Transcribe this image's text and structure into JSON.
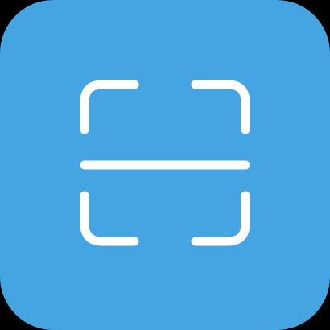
{
  "app_icon": {
    "icon": "scan-icon",
    "background_color": "#45A5E3",
    "glyph_color": "#FFFFFF",
    "outer_background": "#000000"
  }
}
